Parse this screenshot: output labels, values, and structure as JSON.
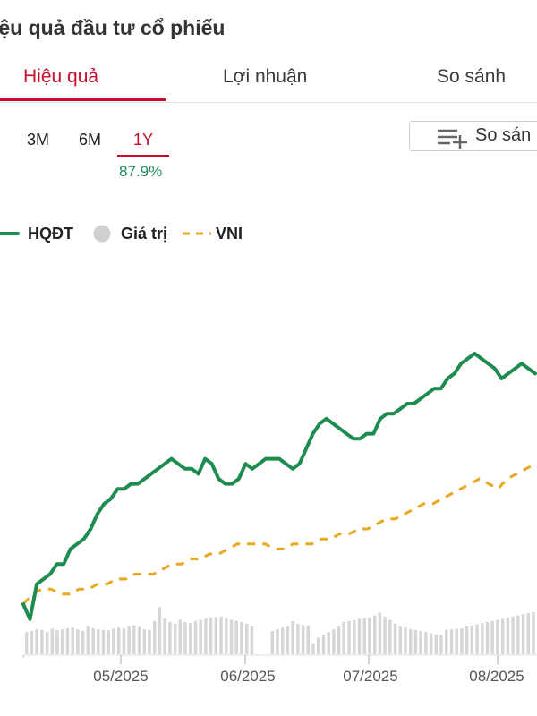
{
  "header": {
    "title": "iệu quả đầu tư cổ phiếu"
  },
  "tabs": [
    {
      "label": "Hiệu quả",
      "active": true
    },
    {
      "label": "Lợi nhuận",
      "active": false
    },
    {
      "label": "So sánh",
      "active": false
    }
  ],
  "ranges": [
    {
      "label": "3M",
      "active": false
    },
    {
      "label": "6M",
      "active": false
    },
    {
      "label": "1Y",
      "active": true
    }
  ],
  "selected_return": "87.9%",
  "compare_button": {
    "label": "So sán",
    "icon": "add-list-icon"
  },
  "legend": [
    {
      "label": "HQĐT",
      "color": "#1e8c50",
      "style": "solid-line"
    },
    {
      "label": "Giá trị",
      "color": "#d0d0d0",
      "style": "dot"
    },
    {
      "label": "VNI",
      "color": "#e8a820",
      "style": "dashed-line"
    }
  ],
  "colors": {
    "accent": "#c8102e",
    "positive": "#1f8a55"
  },
  "chart_data": {
    "type": "line",
    "x_ticks": [
      "05/2025",
      "06/2025",
      "07/2025",
      "08/2025"
    ],
    "grid": false,
    "series": [
      {
        "name": "HQĐT",
        "values": [
          0,
          -3,
          4,
          5,
          6,
          8,
          8,
          11,
          12,
          13,
          15,
          18,
          20,
          21,
          23,
          23,
          24,
          24,
          25,
          26,
          27,
          28,
          29,
          28,
          27,
          27,
          26,
          29,
          28,
          25,
          24,
          24,
          25,
          28,
          27,
          28,
          29,
          29,
          29,
          28,
          27,
          28,
          31,
          34,
          36,
          37,
          36,
          35,
          34,
          33,
          33,
          34,
          34,
          37,
          38,
          38,
          39,
          40,
          40,
          41,
          42,
          43,
          43,
          45,
          46,
          48,
          49,
          50,
          49,
          48,
          47,
          45,
          46,
          47,
          48,
          47,
          46
        ]
      },
      {
        "name": "VNI",
        "values": [
          0,
          2,
          3,
          3,
          2,
          2,
          3,
          3,
          4,
          4,
          5,
          5,
          6,
          6,
          6,
          7,
          8,
          8,
          9,
          9,
          10,
          10,
          11,
          12,
          12,
          12,
          12,
          11,
          11,
          12,
          12,
          12,
          13,
          13,
          14,
          14,
          15,
          15,
          16,
          17,
          17,
          18,
          19,
          20,
          20,
          21,
          22,
          23,
          24,
          25,
          24,
          23,
          25,
          26,
          27,
          28
        ]
      },
      {
        "name": "Giá trị",
        "values": [
          40,
          42,
          45,
          44,
          40,
          46,
          43,
          45,
          47,
          48,
          45,
          42,
          50,
          47,
          45,
          44,
          43,
          46,
          48,
          47,
          50,
          52,
          49,
          45,
          44,
          60,
          85,
          65,
          58,
          55,
          62,
          58,
          56,
          60,
          62,
          64,
          66,
          67,
          68,
          65,
          62,
          60,
          58,
          55,
          50,
          0,
          0,
          0,
          42,
          45,
          48,
          50,
          60,
          55,
          53,
          52,
          20,
          30,
          35,
          40,
          45,
          50,
          58,
          60,
          62,
          64,
          65,
          66,
          70,
          75,
          68,
          62,
          55,
          50,
          48,
          45,
          44,
          42,
          40,
          38,
          36,
          35,
          44,
          45,
          46,
          47,
          50,
          52,
          54,
          56,
          58,
          60,
          62,
          64,
          66,
          68,
          70,
          72,
          74,
          76
        ]
      }
    ]
  }
}
